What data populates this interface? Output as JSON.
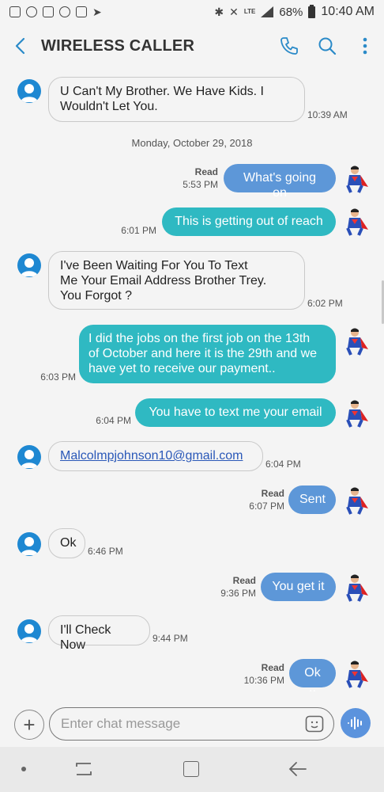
{
  "status_bar": {
    "battery": "68%",
    "time": "10:40 AM",
    "network": "LTE"
  },
  "header": {
    "title": "WIRELESS CALLER"
  },
  "date_separator": "Monday, October 29, 2018",
  "messages": [
    {
      "dir": "in",
      "lines": [
        "U Can't My Brother. We Have Kids. I",
        "Wouldn't Let You."
      ],
      "time": "10:39 AM"
    },
    {
      "dir": "out",
      "lines": [
        "What's going on"
      ],
      "status": "Read",
      "time": "5:53 PM"
    },
    {
      "dir": "out",
      "lines": [
        "This is getting out of reach"
      ],
      "time": "6:01 PM"
    },
    {
      "dir": "in",
      "lines": [
        "I've Been Waiting For You To Text",
        "Me Your Email Address Brother Trey.",
        "You Forgot  ?"
      ],
      "time": "6:02 PM"
    },
    {
      "dir": "out",
      "lines": [
        "I did the jobs on the first job on the 13th",
        "of October and here it is the 29th and we",
        "have yet to receive our payment.."
      ],
      "time": "6:03 PM"
    },
    {
      "dir": "out",
      "lines": [
        "You have to text me your email"
      ],
      "time": "6:04 PM"
    },
    {
      "dir": "in",
      "lines": [
        "Malcolmpjohnson10@gmail.com"
      ],
      "time": "6:04 PM"
    },
    {
      "dir": "out",
      "lines": [
        "Sent"
      ],
      "status": "Read",
      "time": "6:07 PM"
    },
    {
      "dir": "in",
      "lines": [
        "Ok"
      ],
      "time": "6:46 PM"
    },
    {
      "dir": "out",
      "lines": [
        "You get it"
      ],
      "status": "Read",
      "time": "9:36 PM"
    },
    {
      "dir": "in",
      "lines": [
        "I'll Check Now"
      ],
      "time": "9:44 PM"
    },
    {
      "dir": "out",
      "lines": [
        "Ok .."
      ],
      "status": "Read",
      "time": "10:36 PM"
    }
  ],
  "composer": {
    "placeholder": "Enter chat message"
  },
  "colors": {
    "accent": "#2a8ac8",
    "bubble_blue": "#5d97d8",
    "bubble_teal": "#2fb9c2",
    "avatar_bg": "#1e88d2"
  },
  "icons": [
    "back-arrow-icon",
    "phone-icon",
    "search-icon",
    "more-vert-icon",
    "plus-icon",
    "sticker-icon",
    "voice-icon",
    "recent-apps-icon",
    "home-icon",
    "nav-back-icon"
  ]
}
